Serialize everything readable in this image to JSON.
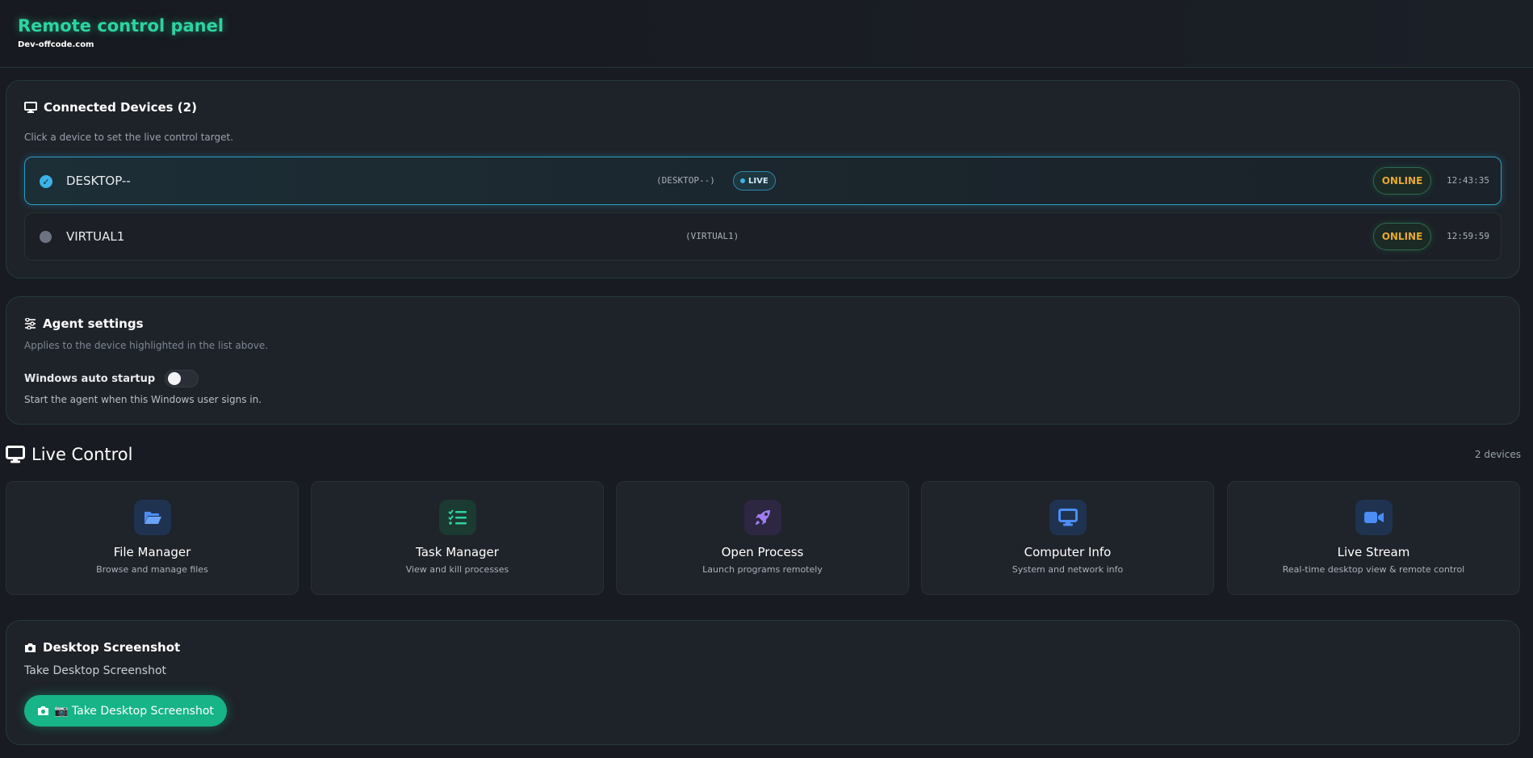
{
  "header": {
    "title": "Remote control panel",
    "subtitle": "Dev-offcode.com"
  },
  "devices": {
    "title": "Connected Devices (2)",
    "hint": "Click a device to set the live control target.",
    "items": [
      {
        "name": "DESKTOP--",
        "host": "(DESKTOP--)",
        "badge": "LIVE",
        "status": "ONLINE",
        "time": "12:43:35",
        "selected": true
      },
      {
        "name": "VIRTUAL1",
        "host": "(VIRTUAL1)",
        "status": "ONLINE",
        "time": "12:59:59",
        "selected": false
      }
    ]
  },
  "agent": {
    "title": "Agent settings",
    "hint": "Applies to the device highlighted in the list above.",
    "toggle_label": "Windows auto startup",
    "toggle_hint": "Start the agent when this Windows user signs in.",
    "toggle_on": false
  },
  "live_control": {
    "title": "Live Control",
    "count": "2 devices",
    "tools": [
      {
        "name": "File Manager",
        "desc": "Browse and manage files",
        "icon": "folder-open-icon",
        "color": "#4c8df6"
      },
      {
        "name": "Task Manager",
        "desc": "View and kill processes",
        "icon": "list-check-icon",
        "color": "#2dd4a0"
      },
      {
        "name": "Open Process",
        "desc": "Launch programs remotely",
        "icon": "rocket-icon",
        "color": "#a07cf0"
      },
      {
        "name": "Computer Info",
        "desc": "System and network info",
        "icon": "monitor-icon",
        "color": "#4c8df6"
      },
      {
        "name": "Live Stream",
        "desc": "Real-time desktop view & remote control",
        "icon": "video-icon",
        "color": "#4c8df6"
      }
    ]
  },
  "screenshot": {
    "title": "Desktop Screenshot",
    "label": "Take Desktop Screenshot",
    "button": "📷 Take Desktop Screenshot"
  }
}
